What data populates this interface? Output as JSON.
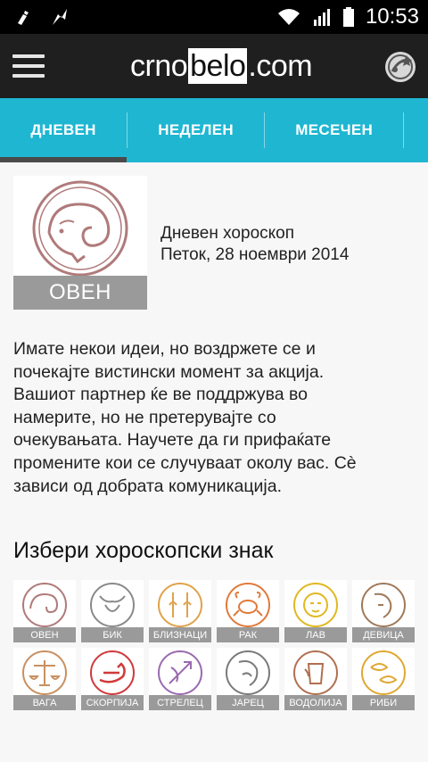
{
  "status": {
    "time": "10:53"
  },
  "app": {
    "logo_left": "crno",
    "logo_mid": "belo",
    "logo_right": ".com"
  },
  "tabs": [
    {
      "label": "ДНЕВЕН",
      "active": true
    },
    {
      "label": "НЕДЕЛЕН",
      "active": false
    },
    {
      "label": "МЕСЕЧЕН",
      "active": false
    }
  ],
  "horoscope": {
    "sign": "ОВЕН",
    "type": "Дневен хороскоп",
    "date": "Петок, 28 ноември 2014",
    "lines": [
      "Имате некои идеи, но воздржете се и",
      "почекајте вистински момент за акција.",
      "Вашиот партнер ќе ве поддржува во",
      "намерите, но не претерувајте со",
      "очекувањата. Научете да ги прифаќате",
      "промените кои се случуваат околу вас. Сè",
      "зависи од добрата комуникација."
    ]
  },
  "picker": {
    "title": "Избери хороскопски знак",
    "signs": [
      {
        "label": "ОВЕН",
        "icon": "ram-icon",
        "color": "#b07a7a"
      },
      {
        "label": "БИК",
        "icon": "bull-icon",
        "color": "#8a8a8a"
      },
      {
        "label": "БЛИЗНАЦИ",
        "icon": "twins-icon",
        "color": "#e0a24a"
      },
      {
        "label": "РАК",
        "icon": "crab-icon",
        "color": "#e07a3a"
      },
      {
        "label": "ЛАВ",
        "icon": "lion-icon",
        "color": "#e0b820"
      },
      {
        "label": "ДЕВИЦА",
        "icon": "virgin-icon",
        "color": "#a07a5a"
      },
      {
        "label": "ВАГА",
        "icon": "scales-icon",
        "color": "#c89060"
      },
      {
        "label": "СКОРПИЈА",
        "icon": "scorpion-icon",
        "color": "#d0393a"
      },
      {
        "label": "СТРЕЛЕЦ",
        "icon": "archer-icon",
        "color": "#9a6ab0"
      },
      {
        "label": "ЈАРЕЦ",
        "icon": "goat-icon",
        "color": "#7a7a7a"
      },
      {
        "label": "ВОДОЛИЈА",
        "icon": "water-bearer-icon",
        "color": "#b07050"
      },
      {
        "label": "РИБИ",
        "icon": "fish-icon",
        "color": "#e0a830"
      }
    ]
  }
}
